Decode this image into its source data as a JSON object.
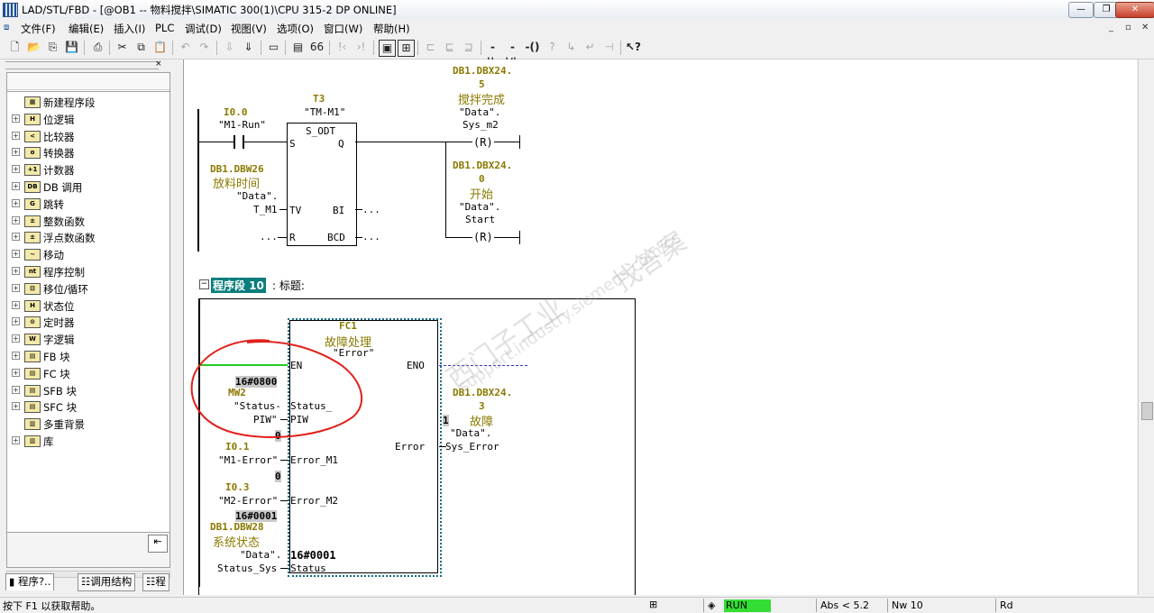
{
  "titlebar": {
    "title": "LAD/STL/FBD  - [@OB1 -- 物料搅拌\\SIMATIC 300(1)\\CPU 315-2 DP  ONLINE]"
  },
  "menu": [
    "文件(F)",
    "编辑(E)",
    "插入(I)",
    "PLC",
    "调试(D)",
    "视图(V)",
    "选项(O)",
    "窗口(W)",
    "帮助(H)"
  ],
  "tree": [
    {
      "label": "新建程序段",
      "icon": "new-network-icon",
      "expand": false
    },
    {
      "label": "位逻辑",
      "icon": "bit-logic-icon",
      "expand": true
    },
    {
      "label": "比较器",
      "icon": "comparator-icon",
      "expand": true
    },
    {
      "label": "转换器",
      "icon": "converter-icon",
      "expand": true
    },
    {
      "label": "计数器",
      "icon": "counter-icon",
      "expand": true
    },
    {
      "label": "DB 调用",
      "icon": "db-call-icon",
      "expand": true
    },
    {
      "label": "跳转",
      "icon": "jump-icon",
      "expand": true
    },
    {
      "label": "整数函数",
      "icon": "integer-function-icon",
      "expand": true
    },
    {
      "label": "浮点数函数",
      "icon": "float-function-icon",
      "expand": true
    },
    {
      "label": "移动",
      "icon": "move-icon",
      "expand": true
    },
    {
      "label": "程序控制",
      "icon": "program-control-icon",
      "expand": true
    },
    {
      "label": "移位/循环",
      "icon": "shift-rotate-icon",
      "expand": true
    },
    {
      "label": "状态位",
      "icon": "status-bit-icon",
      "expand": true
    },
    {
      "label": "定时器",
      "icon": "timer-icon",
      "expand": true
    },
    {
      "label": "字逻辑",
      "icon": "word-logic-icon",
      "expand": true
    },
    {
      "label": "FB 块",
      "icon": "fb-block-icon",
      "expand": true
    },
    {
      "label": "FC 块",
      "icon": "fc-block-icon",
      "expand": true
    },
    {
      "label": "SFB 块",
      "icon": "sfb-block-icon",
      "expand": true
    },
    {
      "label": "SFC 块",
      "icon": "sfc-block-icon",
      "expand": true
    },
    {
      "label": "多重背景",
      "icon": "multi-instance-icon",
      "expand": false
    },
    {
      "label": "库",
      "icon": "library-icon",
      "expand": true
    }
  ],
  "bottom_tabs": [
    "程序?..",
    "调用结构",
    "程"
  ],
  "network9": {
    "i00_addr": "I0.0",
    "i00_sym": "\"M1-Run\"",
    "t3_addr": "T3",
    "t3_sym": "\"TM-M1\"",
    "t3_type": "S_ODT",
    "pin_s": "S",
    "pin_q": "Q",
    "pin_tv": "TV",
    "pin_bi": "BI",
    "pin_r": "R",
    "pin_bcd": "BCD",
    "tv_addr": "DB1.DBW26",
    "tv_cn": "放料时间",
    "tv_sym1": "\"Data\".",
    "tv_sym2": "T_M1",
    "ellipsis": "...",
    "coil1_addr1": "DB1.DBX24.",
    "coil1_addr2": "5",
    "coil1_cn": "搅拌完成",
    "coil1_sym1": "\"Data\".",
    "coil1_sym2": "Sys_m2",
    "coil2_addr1": "DB1.DBX24.",
    "coil2_addr2": "0",
    "coil2_cn": "开始",
    "coil2_sym1": "\"Data\".",
    "coil2_sym2": "Start",
    "coil_r": "(R)"
  },
  "network10": {
    "label": "程序段  10",
    "title_suffix": ": 标题:",
    "fc_name": "FC1",
    "fc_cn": "故障处理",
    "fc_sym": "\"Error\"",
    "pin_en": "EN",
    "pin_eno": "ENO",
    "status_piw_val": "16#0800",
    "status_piw_addr": "MW2",
    "status_piw_sym1": "\"Status-",
    "status_piw_sym2": "PIW\"",
    "pin_status_piw1": "Status_",
    "pin_status_piw2": "PIW",
    "m1err_val": "0",
    "m1err_addr": "I0.1",
    "m1err_sym": "\"M1-Error\"",
    "pin_error_m1": "Error_M1",
    "m2err_val": "0",
    "m2err_addr": "I0.3",
    "m2err_sym": "\"M2-Error\"",
    "pin_error_m2": "Error_M2",
    "sys_val": "16#0001",
    "sys_addr": "DB1.DBW28",
    "sys_cn": "系统状态",
    "sys_sym1": "\"Data\".",
    "sys_sym2": "Status_Sys",
    "pin_status": "Status",
    "status_val": "16#0001",
    "pin_error": "Error",
    "err_out_val": "1",
    "err_addr1": "DB1.DBX24.",
    "err_addr2": "3",
    "err_cn": "故障",
    "err_sym1": "\"Data\".",
    "err_sym2": "Sys_Error"
  },
  "watermark": {
    "line1": "找答案",
    "line2": "西门子工业",
    "line3": "support.industry.siemens.com/cs"
  },
  "statusbar": {
    "help": "按下 F1 以获取帮助。",
    "mode": "RUN",
    "abs": "Abs < 5.2",
    "nw": "Nw 10",
    "rd": "Rd"
  },
  "colors": {
    "run": "#33dd33",
    "symbol": "#8a7a00",
    "network_label_bg": "#0a7d7d",
    "annotation": "#e0201c",
    "powerflow": "#22cc22"
  }
}
